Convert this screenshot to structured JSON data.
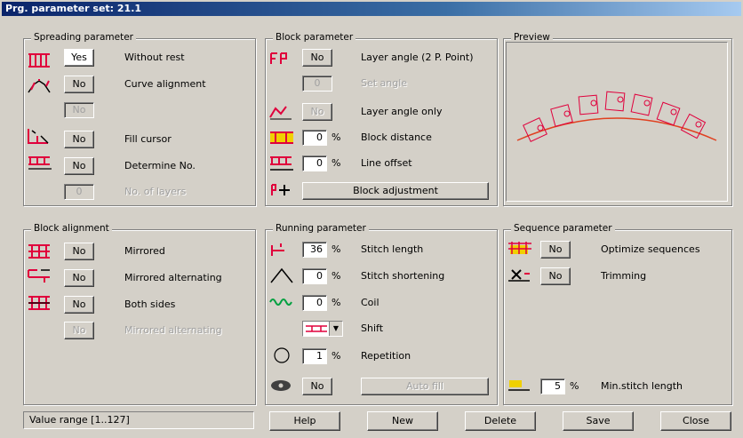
{
  "window": {
    "title": "Prg. parameter set: 21.1"
  },
  "spreading": {
    "title": "Spreading parameter",
    "without_rest": {
      "value": "Yes",
      "label": "Without rest"
    },
    "curve_alignment": {
      "value": "No",
      "label": "Curve alignment"
    },
    "curve_sub": {
      "value": "No"
    },
    "fill_cursor": {
      "value": "No",
      "label": "Fill cursor"
    },
    "determine_no": {
      "value": "No",
      "label": "Determine No."
    },
    "determine_sub": {
      "value": "0",
      "label": "No. of layers"
    }
  },
  "block_param": {
    "title": "Block parameter",
    "layer_angle_2p": {
      "value": "No",
      "label": "Layer angle (2 P. Point)"
    },
    "angle_sub": {
      "value": "0",
      "label": "Set angle"
    },
    "layer_angle_only": {
      "value": "No",
      "label": "Layer angle only"
    },
    "block_distance": {
      "value": "0",
      "unit": "%",
      "label": "Block distance"
    },
    "line_offset": {
      "value": "0",
      "unit": "%",
      "label": "Line offset"
    },
    "block_adjustment": {
      "label": "Block adjustment"
    }
  },
  "preview": {
    "title": "Preview"
  },
  "block_alignment": {
    "title": "Block alignment",
    "mirrored": {
      "value": "No",
      "label": "Mirrored"
    },
    "mirrored_alternating": {
      "value": "No",
      "label": "Mirrored alternating"
    },
    "both_sides": {
      "value": "No",
      "label": "Both sides"
    },
    "sub": {
      "value": "No",
      "label": "Mirrored alternating"
    }
  },
  "running": {
    "title": "Running parameter",
    "stitch_length": {
      "value": "36",
      "unit": "%",
      "label": "Stitch length"
    },
    "stitch_shortening": {
      "value": "0",
      "unit": "%",
      "label": "Stitch shortening"
    },
    "coil": {
      "value": "0",
      "unit": "%",
      "label": "Coil"
    },
    "shift": {
      "label": "Shift"
    },
    "repetition": {
      "value": "1",
      "unit": "%",
      "label": "Repetition"
    },
    "last": {
      "value": "No",
      "label": "Auto fill"
    }
  },
  "sequence": {
    "title": "Sequence parameter",
    "optimize_sequences": {
      "value": "No",
      "label": "Optimize sequences"
    },
    "trimming": {
      "value": "No",
      "label": "Trimming"
    },
    "min_stitch": {
      "value": "5",
      "unit": "%",
      "label": "Min.stitch length"
    }
  },
  "footer": {
    "status": "Value range [1..127]",
    "help": "Help",
    "new": "New",
    "delete": "Delete",
    "save": "Save",
    "close": "Close"
  },
  "colors": {
    "accent_red": "#e0003c",
    "title_blue": "#0a246a"
  }
}
